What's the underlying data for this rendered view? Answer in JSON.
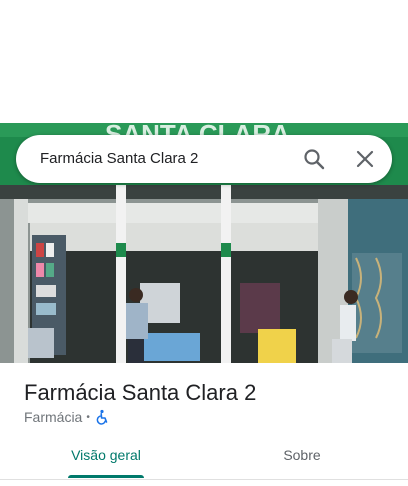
{
  "search": {
    "query": "Farmácia Santa Clara 2",
    "search_icon": "search-icon",
    "clear_icon": "close-icon"
  },
  "photo": {
    "sign_text": "SANTA CLARA",
    "sign_color": "#1f8a4a"
  },
  "place": {
    "name": "Farmácia Santa Clara 2",
    "category": "Farmácia",
    "separator": "•",
    "accessibility_icon": "wheelchair-icon"
  },
  "tabs": [
    {
      "label": "Visão geral",
      "active": true
    },
    {
      "label": "Sobre",
      "active": false
    }
  ],
  "colors": {
    "accent": "#00796b",
    "accessibility_blue": "#1a73e8"
  }
}
